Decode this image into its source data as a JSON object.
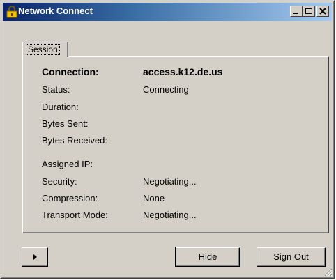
{
  "window": {
    "title": "Network Connect"
  },
  "tabs": [
    {
      "label": "Session"
    }
  ],
  "session": {
    "connection_label": "Connection:",
    "connection_value": "access.k12.de.us",
    "status_label": "Status:",
    "status_value": "Connecting",
    "duration_label": "Duration:",
    "bytes_sent_label": "Bytes Sent:",
    "bytes_received_label": "Bytes Received:",
    "assigned_ip_label": "Assigned IP:",
    "security_label": "Security:",
    "security_value": "Negotiating...",
    "compression_label": "Compression:",
    "compression_value": "None",
    "transport_label": "Transport Mode:",
    "transport_value": "Negotiating..."
  },
  "buttons": {
    "hide": "Hide",
    "sign_out": "Sign Out"
  },
  "icons": {
    "title": "padlock-icon",
    "expand": "play-arrow-icon"
  },
  "colors": {
    "titlebar_start": "#0a246a",
    "titlebar_end": "#a6caf0",
    "face": "#d4d0c8"
  }
}
